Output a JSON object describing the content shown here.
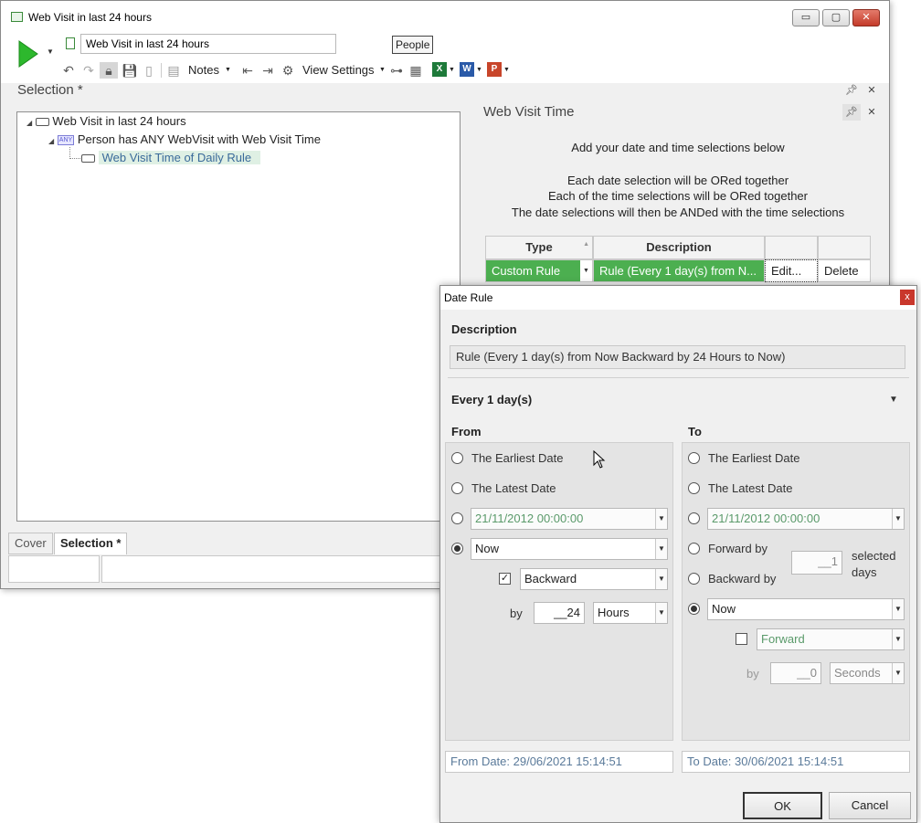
{
  "window": {
    "title": "Web Visit in last 24 hours",
    "min": "▭",
    "max": "▢",
    "close": "✕"
  },
  "ribbon": {
    "name_value": "Web Visit in last 24 hours",
    "people_label": "People",
    "notes_label": "Notes",
    "view_settings_label": "View Settings"
  },
  "selection": {
    "header": "Selection *",
    "tree": [
      {
        "label": "Web Visit in last 24 hours"
      },
      {
        "badge": "ANY",
        "label": "Person has ANY WebVisit with Web Visit Time"
      },
      {
        "label": "Web Visit Time of Daily Rule"
      }
    ]
  },
  "right_panel": {
    "title": "Web Visit Time",
    "intro": "Add your date and time selections below",
    "line1": "Each date selection will be ORed together",
    "line2": "Each of the time selections will be ORed together",
    "line3": "The date selections will then be ANDed with the time selections",
    "table": {
      "col_type": "Type",
      "col_description": "Description",
      "row": {
        "type": "Custom Rule",
        "description": "Rule (Every 1 day(s) from N...",
        "edit": "Edit...",
        "delete": "Delete"
      }
    }
  },
  "tabs": [
    "Cover",
    "Selection *"
  ],
  "dialog": {
    "title": "Date Rule",
    "close": "x",
    "description_label": "Description",
    "description_value": "Rule (Every 1 day(s) from Now Backward by 24 Hours to Now)",
    "frequency": "Every 1 day(s)",
    "from": {
      "label": "From",
      "earliest": "The Earliest Date",
      "latest": "The Latest Date",
      "date_value": "21/11/2012 00:00:00",
      "anchor": "Now",
      "direction": "Backward",
      "by_label": "by",
      "amount": "__24",
      "unit": "Hours",
      "result": "From Date: 29/06/2021 15:14:51"
    },
    "to": {
      "label": "To",
      "earliest": "The Earliest Date",
      "latest": "The Latest Date",
      "date_value": "21/11/2012 00:00:00",
      "forward_by": "Forward by",
      "backward_by": "Backward by",
      "days_amount": "__1",
      "selected_days_1": "selected",
      "selected_days_2": "days",
      "anchor": "Now",
      "direction": "Forward",
      "by_label": "by",
      "amount": "__0",
      "unit": "Seconds",
      "result": "To Date: 30/06/2021 15:14:51"
    },
    "ok": "OK",
    "cancel": "Cancel"
  },
  "colors": {
    "accent_green": "#4caf50",
    "run_green": "#2db82d",
    "highlight": "#dff0e4"
  }
}
